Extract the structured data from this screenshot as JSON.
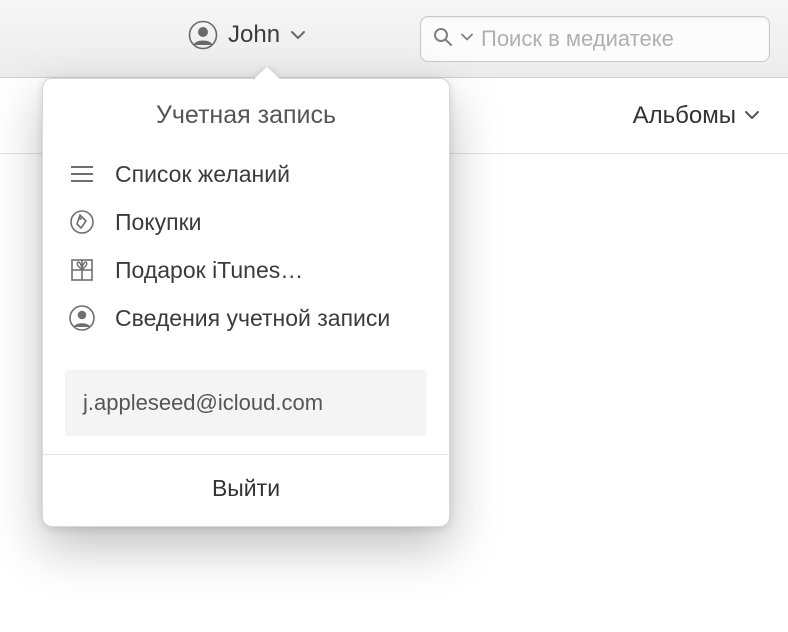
{
  "toolbar": {
    "account_name": "John",
    "search_placeholder": "Поиск в медиатеке"
  },
  "subbar": {
    "view_label": "Альбомы"
  },
  "popover": {
    "title": "Учетная запись",
    "items": [
      {
        "label": "Список желаний"
      },
      {
        "label": "Покупки"
      },
      {
        "label": "Подарок iTunes…"
      },
      {
        "label": "Сведения учетной записи"
      }
    ],
    "email": "j.appleseed@icloud.com",
    "sign_out": "Выйти"
  }
}
